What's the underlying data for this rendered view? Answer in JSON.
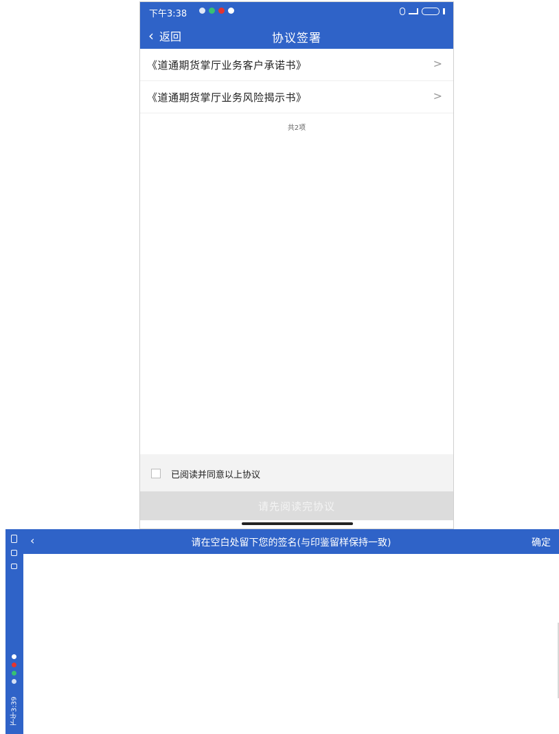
{
  "phone": {
    "status": {
      "time": "下午3:38"
    },
    "nav": {
      "back_label": "返回",
      "title": "协议签署"
    },
    "agreements": [
      {
        "label": "《道通期货掌厅业务客户承诺书》"
      },
      {
        "label": "《道通期货掌厅业务风险揭示书》"
      }
    ],
    "count_text": "共2项",
    "agree_label": "已阅读并同意以上协议",
    "submit_label": "请先阅读完协议"
  },
  "signature": {
    "title": "请在空白处留下您的签名(与印鉴留样保持一致)",
    "confirm_label": "确定",
    "status_time": "下午3:39"
  },
  "colors": {
    "primary": "#2f63c8",
    "disabled_button": "#dcdcdc",
    "agree_bar_bg": "#f3f3f3"
  },
  "icons": {
    "back": "chevron-left-icon",
    "row_arrow": "chevron-right-icon",
    "checkbox": "checkbox-icon"
  }
}
